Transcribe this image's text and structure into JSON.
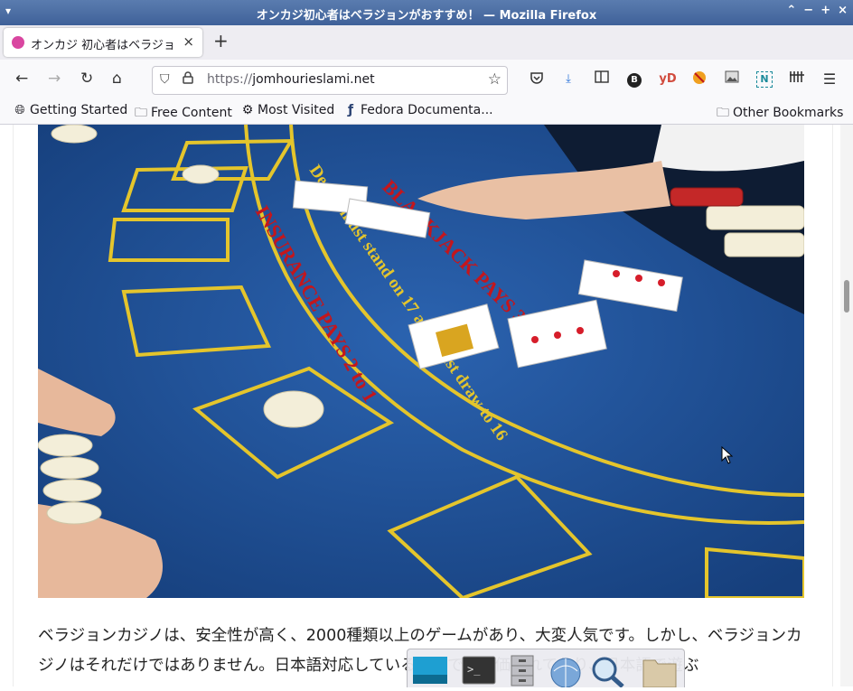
{
  "window": {
    "title": "オンカジ初心者はベラジョンがおすすめ！ — Mozilla Firefox"
  },
  "tab": {
    "title": "オンカジ 初心者はベラジョ",
    "close": "×"
  },
  "toolbar": {
    "url_scheme": "https://",
    "url_host": "jomhourieslami.net",
    "ext_b": "B",
    "ext_yd": "yD",
    "ext_n": "N"
  },
  "bookmarks": {
    "items": [
      {
        "label": "Getting Started",
        "icon": "globe-icon"
      },
      {
        "label": "Free Content",
        "icon": "folder-icon"
      },
      {
        "label": "Most Visited",
        "icon": "gear-icon"
      },
      {
        "label": "Fedora Documenta...",
        "icon": "fedora-icon"
      }
    ],
    "other": "Other Bookmarks"
  },
  "article": {
    "paragraph": "ベラジョンカジノは、安全性が高く、2000種類以上のゲームがあり、大変人気です。しかし、ベラジョンカジノはそれだけではありません。日本語対応していることでも評価されており、日本語で遊ぶ"
  },
  "colors": {
    "felt": "#1e4f95",
    "table_lines": "#e4c52c",
    "table_text": "#c4161c",
    "titlebar": "#4a6ca3"
  }
}
